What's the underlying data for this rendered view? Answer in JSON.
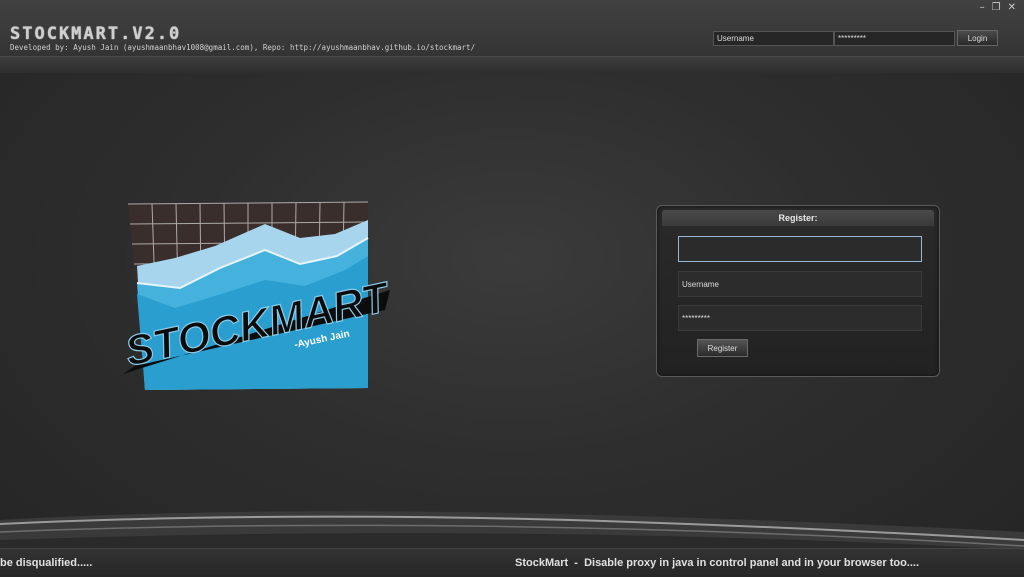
{
  "header": {
    "title": "STOCKMART.V2.0",
    "subtitle": "Developed by: Ayush Jain (ayushmaanbhav1008@gmail.com), Repo: http://ayushmaanbhav.github.io/stockmart/",
    "window_controls": [
      "–",
      "❐",
      "✕"
    ],
    "login": {
      "username_value": "Username",
      "password_value": "*********",
      "login_label": "Login"
    }
  },
  "logo": {
    "main_text": "STOCKMART",
    "byline": "-Ayush Jain"
  },
  "register": {
    "title": "Register:",
    "field1_value": "",
    "username_value": "Username",
    "password_value": "*********",
    "button_label": "Register"
  },
  "ticker": {
    "left_text": "be disqualified.....",
    "right_text": "StockMart  -  Disable proxy in java in control panel and in your browser too...."
  }
}
